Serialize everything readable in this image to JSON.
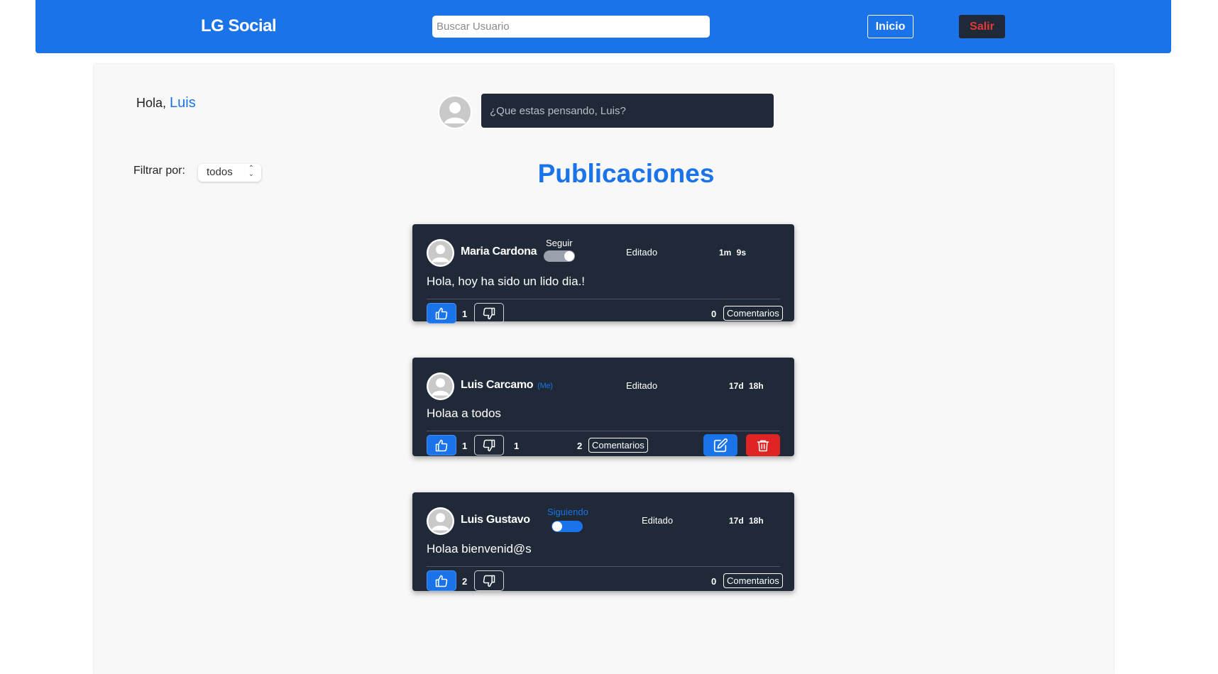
{
  "header": {
    "brand": "LG Social",
    "search_placeholder": "Buscar Usuario",
    "home_label": "Inicio",
    "logout_label": "Salir"
  },
  "greeting": {
    "prefix": "Hola, ",
    "user_name": "Luis"
  },
  "composer": {
    "placeholder": "¿Que estas pensando, Luis?"
  },
  "filter": {
    "label": "Filtrar por:",
    "selected": "todos"
  },
  "section_title": "Publicaciones",
  "posts": [
    {
      "author": "Maria Cardona",
      "follow_label": "Seguir",
      "following": false,
      "edited_label": "Editado",
      "time": "1m 9s",
      "text": "Hola, hoy ha sido un lido dia.!",
      "likes": "1",
      "comment_count": "0",
      "comments_label": "Comentarios"
    },
    {
      "author": "Luis Carcamo",
      "me_tag": "(Me)",
      "edited_label": "Editado",
      "time": "17d 18h",
      "text": "Holaa a todos",
      "likes": "1",
      "dislikes": "1",
      "comment_count": "2",
      "comments_label": "Comentarios"
    },
    {
      "author": "Luis Gustavo",
      "follow_label": "Siguiendo",
      "following": true,
      "edited_label": "Editado",
      "time": "17d 18h",
      "text": "Holaa bienvenid@s",
      "likes": "2",
      "comment_count": "0",
      "comments_label": "Comentarios"
    }
  ],
  "colors": {
    "primary": "#1a73e8",
    "card": "#1f2937",
    "danger": "#e02424",
    "page_bg": "#f8f8f8"
  },
  "icons": {
    "like": "thumbs-up-icon",
    "dislike": "thumbs-down-icon",
    "edit": "pencil-square-icon",
    "delete": "trash-icon",
    "avatar": "user-avatar-icon"
  }
}
